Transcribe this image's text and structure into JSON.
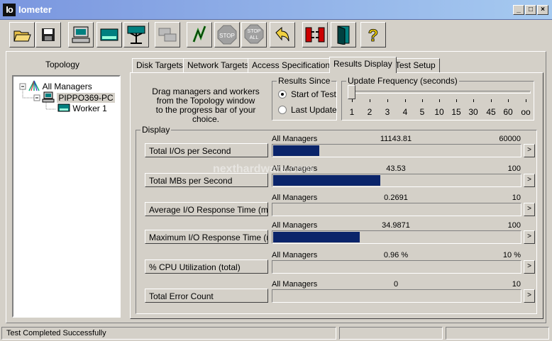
{
  "window": {
    "app_icon_text": "Io",
    "title": "Iometer"
  },
  "toolbar": {
    "buttons": [
      {
        "name": "open-icon"
      },
      {
        "name": "save-icon"
      },
      {
        "name": "new-manager-icon"
      },
      {
        "name": "new-disk-worker-icon"
      },
      {
        "name": "new-network-worker-icon"
      },
      {
        "name": "duplicate-worker-icon"
      },
      {
        "name": "start-tests-icon"
      },
      {
        "name": "stop-icon"
      },
      {
        "name": "stop-all-icon"
      },
      {
        "name": "reset-icon"
      },
      {
        "name": "disconnect-icon"
      },
      {
        "name": "exit-icon"
      },
      {
        "name": "help-icon"
      }
    ],
    "stop_label": "STOP",
    "stop_all_label_1": "STOP",
    "stop_all_label_2": "ALL",
    "help_label": "?"
  },
  "topology": {
    "title": "Topology",
    "root": "All Managers",
    "manager": "PIPPO369-PC",
    "worker": "Worker 1"
  },
  "tabs": [
    {
      "label": "Disk Targets"
    },
    {
      "label": "Network Targets"
    },
    {
      "label": "Access Specifications"
    },
    {
      "label": "Results Display"
    },
    {
      "label": "Test Setup"
    }
  ],
  "results": {
    "hint_line1": "Drag managers and workers",
    "hint_line2": "from the Topology window",
    "hint_line3": "to the progress bar of your choice.",
    "results_since": {
      "title": "Results Since",
      "option1": "Start of Test",
      "option2": "Last Update",
      "selected": "Start of Test"
    },
    "update_frequency": {
      "title": "Update Frequency (seconds)",
      "ticks": [
        "1",
        "2",
        "3",
        "4",
        "5",
        "10",
        "15",
        "30",
        "45",
        "60",
        "oo"
      ],
      "selected": "1"
    },
    "display_title": "Display",
    "metrics": [
      {
        "label": "Total I/Os per Second",
        "source": "All Managers",
        "value": "11143.81",
        "max": "60000",
        "fill": 0.186
      },
      {
        "label": "Total MBs per Second",
        "source": "All Managers",
        "value": "43.53",
        "max": "100",
        "fill": 0.4353
      },
      {
        "label": "Average I/O Response Time (ms)",
        "source": "All Managers",
        "value": "0.2691",
        "max": "10",
        "fill": 0.0
      },
      {
        "label": "Maximum I/O Response Time (ms)",
        "source": "All Managers",
        "value": "34.9871",
        "max": "100",
        "fill": 0.3499
      },
      {
        "label": "% CPU Utilization (total)",
        "source": "All Managers",
        "value": "0.96 %",
        "max": "10 %",
        "fill": 0.0
      },
      {
        "label": "Total Error Count",
        "source": "All Managers",
        "value": "0",
        "max": "10",
        "fill": 0.0
      }
    ],
    "arrow_glyph": ">"
  },
  "status": {
    "text": "Test Completed Successfully"
  },
  "watermark": "nexthardware.com",
  "colors": {
    "bar_fill": "#0a246a",
    "titlebar": "#7a96df"
  }
}
